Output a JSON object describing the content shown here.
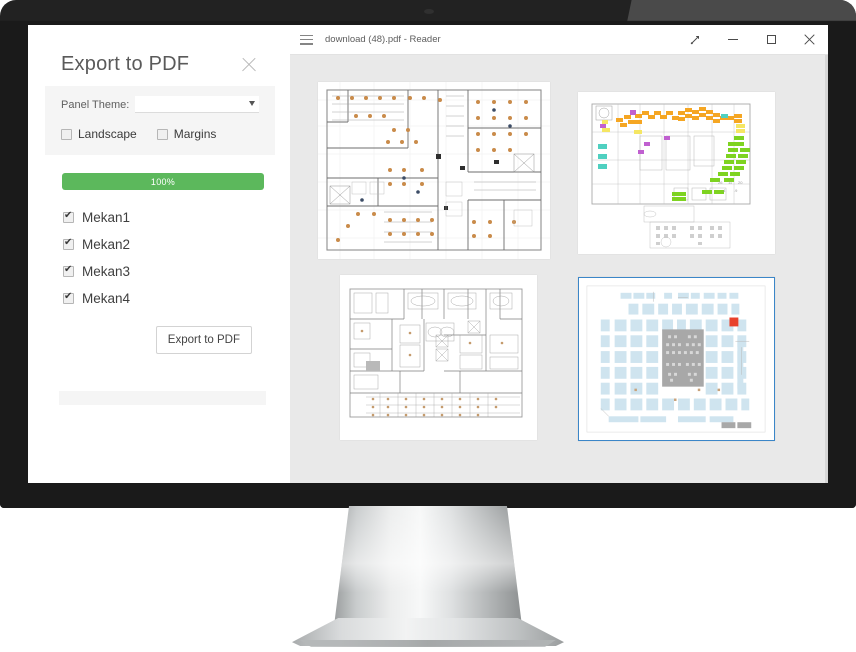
{
  "scene": {
    "device": "desktop-monitor",
    "bezel_color": "#1a1a1a",
    "bezel_highlight_color": "#4a4a4a",
    "stand_color": "#d8dadb"
  },
  "export_panel": {
    "title": "Export to PDF",
    "close_icon": "close-icon",
    "theme": {
      "label": "Panel Theme:",
      "value": "",
      "placeholder": "",
      "caret_icon": "chevron-down-icon",
      "options": []
    },
    "flags": [
      {
        "label": "Landscape",
        "checked": false
      },
      {
        "label": "Margins",
        "checked": false
      }
    ],
    "progress": {
      "label": "100%",
      "percent": 100,
      "color": "#5cb85c",
      "text_color": "#ffffff"
    },
    "items": [
      {
        "label": "Mekan1",
        "checked": true
      },
      {
        "label": "Mekan2",
        "checked": true
      },
      {
        "label": "Mekan3",
        "checked": true
      },
      {
        "label": "Mekan4",
        "checked": true
      }
    ],
    "export_button": "Export to PDF"
  },
  "reader_window": {
    "title": "download (48).pdf - Reader",
    "menu_icon": "hamburger-menu-icon",
    "window_controls": {
      "expand": "expand-arrow-icon",
      "minimize": "minimize-icon",
      "restore": "restore-icon",
      "close": "close-icon"
    },
    "content_background": "#e9e9e9",
    "pages": [
      {
        "name": "page-thumbnail-1",
        "description": "Office floor plan with workstation seating and occupant symbols",
        "selected": false,
        "accent": "#c98b4a"
      },
      {
        "name": "page-thumbnail-2",
        "description": "Floor plan with orange, yellow, green and purple highlighted zone tags",
        "selected": false,
        "accent": "#f5a623"
      },
      {
        "name": "page-thumbnail-3",
        "description": "Grayscale architectural floor plan with offices and meeting rooms",
        "selected": false,
        "accent": "#9a9a9a"
      },
      {
        "name": "page-thumbnail-4",
        "description": "Floor plan with light blue room blocks, central gray hall and one red marker",
        "selected": true,
        "accent": "#cfe4ef",
        "selection_color": "#3b86c8"
      }
    ]
  }
}
